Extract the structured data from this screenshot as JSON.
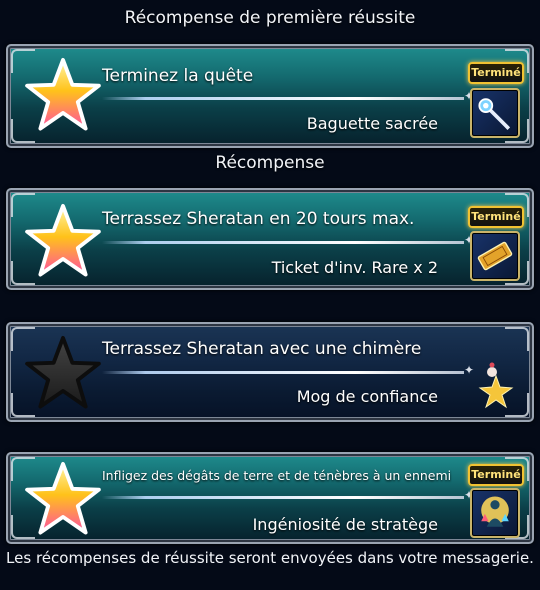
{
  "headers": {
    "first_clear": "Récompense de première réussite",
    "reward": "Récompense"
  },
  "missions": [
    {
      "title": "Terminez la quête",
      "reward": "Baguette sacrée",
      "status": "Terminé",
      "icon": "sacred-wand-icon"
    },
    {
      "title": "Terrassez Sheratan en 20 tours max.",
      "reward": "Ticket d'inv. Rare x 2",
      "status": "Terminé",
      "icon": "rare-summon-ticket-icon"
    },
    {
      "title": "Terrassez Sheratan avec une chimère",
      "reward": "Mog de confiance",
      "icon": "moogle-trust-icon"
    },
    {
      "title": "Infligez des dégâts de terre et de ténèbres à un ennemi",
      "reward": "Ingéniosité de stratège",
      "status": "Terminé",
      "icon": "strategist-ability-icon"
    }
  ],
  "footer": "Les récompenses de réussite seront envoyées dans votre messagerie.",
  "colors": {
    "completed_star": "#ffcf3a",
    "locked_star": "#2a2a2a",
    "badge": "#f1c232"
  }
}
